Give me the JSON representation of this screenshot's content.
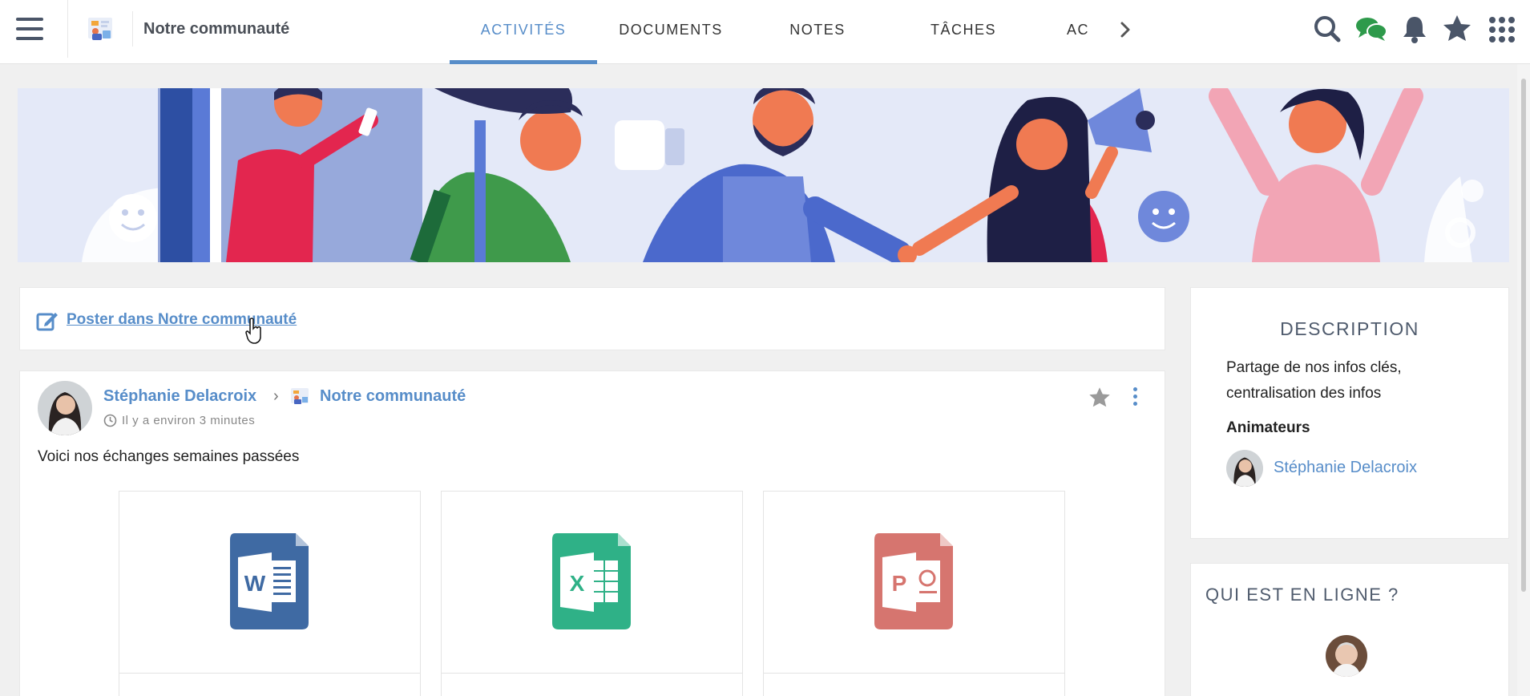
{
  "header": {
    "space_title": "Notre communauté",
    "tabs": [
      {
        "label": "ACTIVITÉS",
        "active": true
      },
      {
        "label": "DOCUMENTS",
        "active": false
      },
      {
        "label": "NOTES",
        "active": false
      },
      {
        "label": "TÂCHES",
        "active": false
      },
      {
        "label": "AC",
        "active": false
      }
    ],
    "icons": [
      "menu-icon",
      "search-icon",
      "chat-icon",
      "bell-icon",
      "star-icon",
      "apps-grid-icon"
    ]
  },
  "composer": {
    "post_label": "Poster dans Notre communauté"
  },
  "activity": {
    "author": "Stéphanie Delacroix",
    "space": "Notre communauté",
    "time": "Il y a environ 3 minutes",
    "message": "Voici nos échanges semaines passées",
    "attachments": [
      {
        "type": "word",
        "icon": "word-file-icon",
        "color": "#3f6aa3",
        "letter": "W"
      },
      {
        "type": "excel",
        "icon": "excel-file-icon",
        "color": "#2fb187",
        "letter": "X"
      },
      {
        "type": "powerpoint",
        "icon": "powerpoint-file-icon",
        "color": "#d6756f",
        "letter": "P"
      }
    ]
  },
  "sidebar": {
    "description": {
      "title": "DESCRIPTION",
      "text": "Partage de nos infos clés, centralisation des infos",
      "animators_title": "Animateurs",
      "animators": [
        "Stéphanie Delacroix"
      ]
    },
    "online": {
      "title": "QUI EST EN LIGNE ?"
    }
  },
  "colors": {
    "accent": "#578dc9",
    "chat": "#2e9a4b",
    "icons": "#4a5568"
  }
}
